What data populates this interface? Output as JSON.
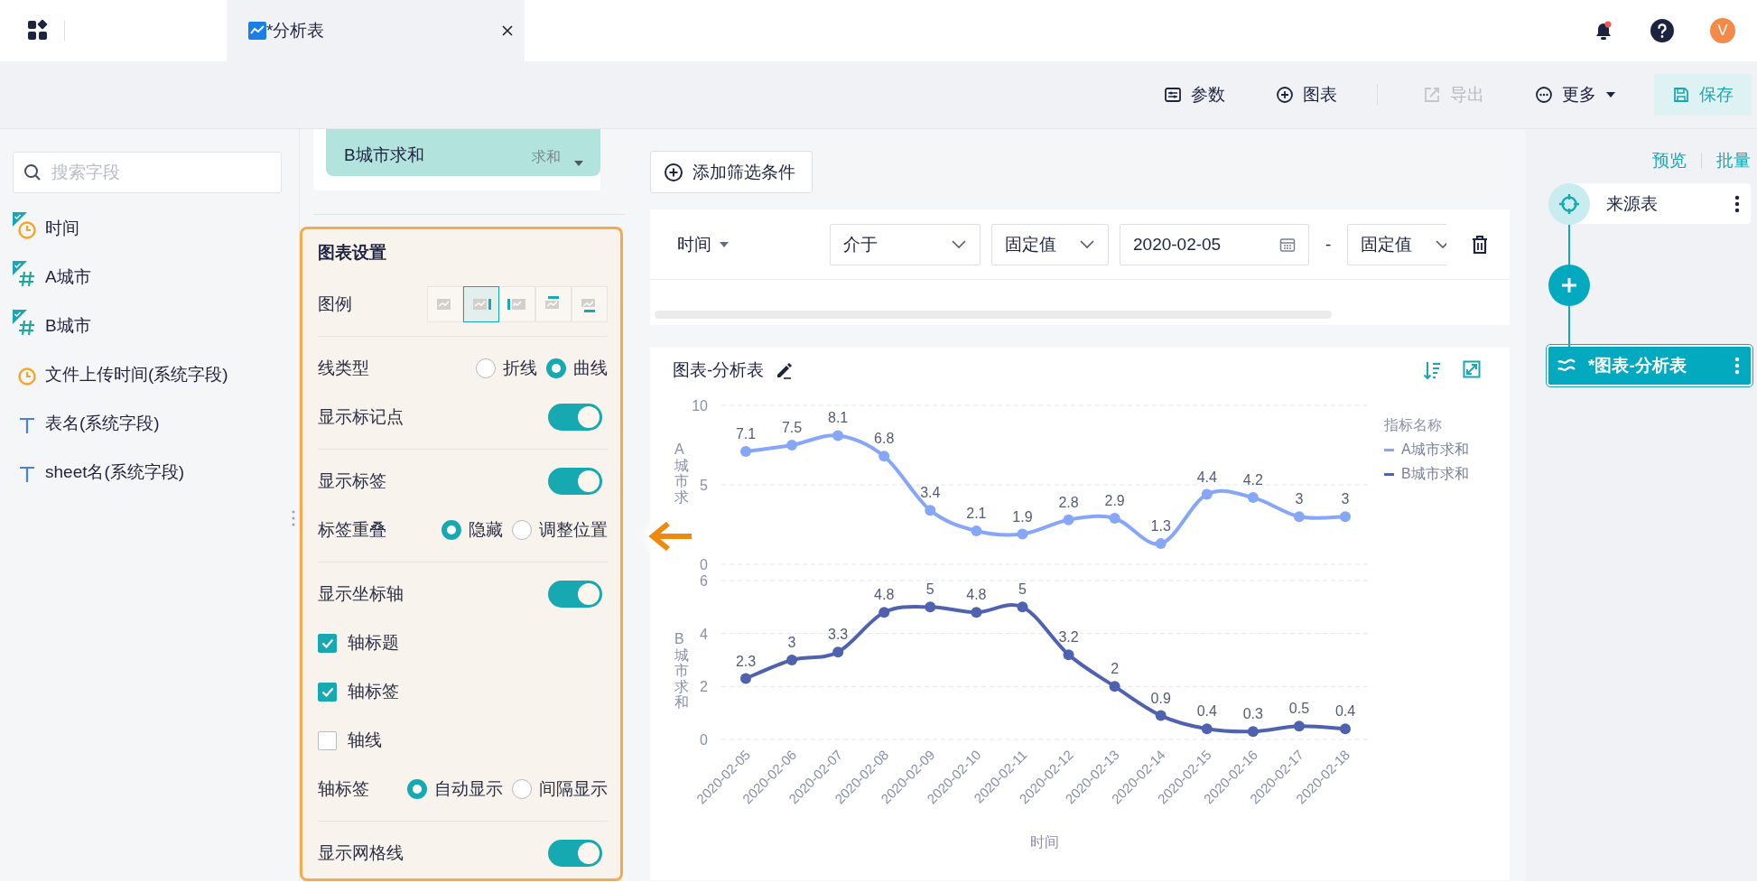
{
  "top_bar": {
    "tabs": [
      {
        "label": "*分析表",
        "selected": true
      }
    ],
    "notification_badge": true,
    "avatar": "V"
  },
  "toolbar": {
    "buttons": [
      {
        "kind": "params",
        "label": "参数",
        "disabled": false
      },
      {
        "kind": "add",
        "label": "图表",
        "disabled": false
      },
      {
        "kind": "export",
        "label": "导出",
        "disabled": true
      },
      {
        "kind": "more",
        "label": "更多",
        "disabled": false
      },
      {
        "kind": "save",
        "label": "保存",
        "disabled": false
      }
    ]
  },
  "fields": {
    "search": {
      "placeholder": "搜索字段"
    },
    "items": [
      {
        "kind": "date",
        "name": "时间",
        "used": true
      },
      {
        "kind": "number",
        "name": "A城市",
        "used": true
      },
      {
        "kind": "number",
        "name": "B城市",
        "used": true
      },
      {
        "kind": "date",
        "name": "文件上传时间(系统字段)",
        "used": false
      },
      {
        "kind": "text",
        "name": "表名(系统字段)",
        "used": false
      },
      {
        "kind": "text",
        "name": "sheet名(系统字段)",
        "used": false
      }
    ]
  },
  "metric_chip": {
    "name": "B城市求和",
    "aggregate": "求和"
  },
  "settings": {
    "title": "图表设置",
    "sections": [
      {
        "rows": [
          {
            "kind": "legend",
            "label": "图例",
            "options": [
              {
                "selected": false
              },
              {
                "selected": true
              },
              {
                "selected": false
              },
              {
                "selected": false
              },
              {
                "selected": false
              }
            ]
          }
        ]
      },
      {
        "rows": [
          {
            "kind": "radio",
            "label": "线类型",
            "options": [
              {
                "label": "折线",
                "selected": false
              },
              {
                "label": "曲线",
                "selected": true
              }
            ]
          },
          {
            "kind": "toggle",
            "label": "显示标记点",
            "on": true
          }
        ]
      },
      {
        "rows": [
          {
            "kind": "toggle",
            "label": "显示标签",
            "on": true
          },
          {
            "kind": "radio",
            "label": "标签重叠",
            "options": [
              {
                "label": "隐藏",
                "selected": true
              },
              {
                "label": "调整位置",
                "selected": false
              }
            ]
          }
        ]
      },
      {
        "rows": [
          {
            "kind": "toggle",
            "label": "显示坐标轴",
            "on": true
          },
          {
            "kind": "checkbox",
            "label": "轴标题",
            "checked": true
          },
          {
            "kind": "checkbox",
            "label": "轴标签",
            "checked": true
          },
          {
            "kind": "checkbox",
            "label": "轴线",
            "checked": false
          },
          {
            "kind": "radio",
            "label": "轴标签",
            "options": [
              {
                "label": "自动显示",
                "selected": true
              },
              {
                "label": "间隔显示",
                "selected": false
              }
            ]
          }
        ]
      },
      {
        "rows": [
          {
            "kind": "toggle",
            "label": "显示网格线",
            "on": true
          }
        ]
      }
    ]
  },
  "filter": {
    "add_button": "添加筛选条件",
    "field": "时间",
    "operator": "介于",
    "start_mode": "固定值",
    "start_value": "2020-02-05",
    "separator": "-",
    "end_mode": "固定值"
  },
  "chart": {
    "title": "图表-分析表",
    "legend_title": "指标名称",
    "panels": [
      {
        "chart_data": {
          "type": "line",
          "ylabel": "A城市求",
          "ylim": [
            0,
            10
          ],
          "yticks": [
            10,
            5,
            0
          ],
          "data_labels": true,
          "series": [
            {
              "name": "A城市求和",
              "color": "#86a6f8",
              "marker": "circle",
              "values": [
                7.1,
                7.5,
                8.1,
                6.8,
                3.4,
                2.1,
                1.9,
                2.8,
                2.9,
                1.3,
                4.4,
                4.2,
                3,
                3
              ]
            }
          ]
        }
      },
      {
        "chart_data": {
          "type": "line",
          "xlabel": "时间",
          "ylabel": "B城市求和",
          "ylim": [
            0,
            6
          ],
          "yticks": [
            6,
            4,
            2,
            0
          ],
          "data_labels": true,
          "categories": [
            "2020-02-05",
            "2020-02-06",
            "2020-02-07",
            "2020-02-08",
            "2020-02-09",
            "2020-02-10",
            "2020-02-11",
            "2020-02-12",
            "2020-02-13",
            "2020-02-14",
            "2020-02-15",
            "2020-02-16",
            "2020-02-17",
            "2020-02-18"
          ],
          "series": [
            {
              "name": "B城市求和",
              "color": "#4f62b0",
              "marker": "circle",
              "values": [
                2.3,
                3,
                3.3,
                4.8,
                5,
                4.8,
                5,
                3.2,
                2,
                0.9,
                0.4,
                0.3,
                0.5,
                0.4
              ]
            }
          ]
        }
      }
    ]
  },
  "flow": {
    "links": [
      "预览",
      "批量"
    ],
    "nodes": [
      {
        "kind": "source",
        "label": "来源表",
        "selected": false
      },
      {
        "kind": "add"
      },
      {
        "kind": "chart",
        "label": "*图表-分析表",
        "selected": true
      }
    ]
  }
}
